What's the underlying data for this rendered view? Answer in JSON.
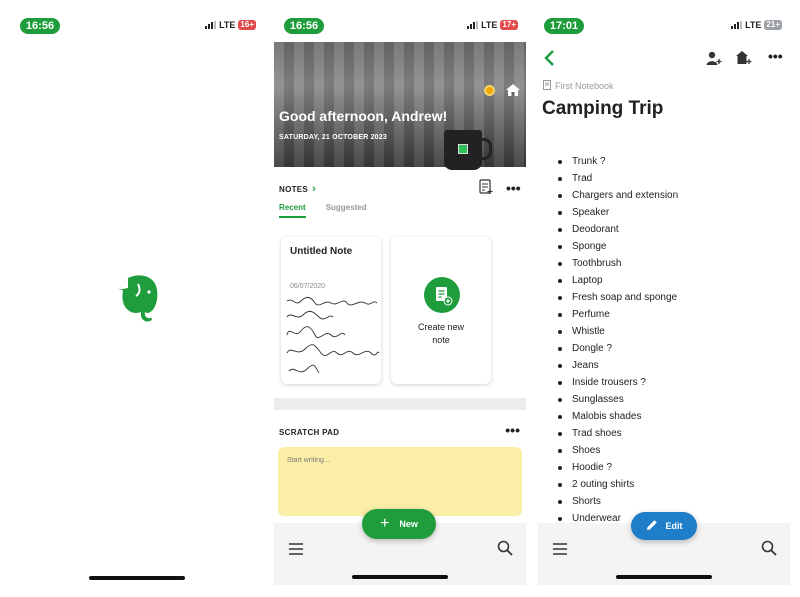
{
  "colors": {
    "brand_green": "#1f9d3c",
    "edit_blue": "#1e7ec8",
    "scratch_yellow": "#fbeea6"
  },
  "screen1": {
    "status": {
      "time": "16:56",
      "network": "LTE",
      "battery": "16+"
    },
    "logo_icon": "evernote-elephant-icon"
  },
  "screen2": {
    "status": {
      "time": "16:56",
      "network": "LTE",
      "battery": "17+"
    },
    "greeting": "Good afternoon, Andrew!",
    "date": "SATURDAY, 21 OCTOBER 2023",
    "notes_label": "NOTES",
    "tabs": [
      "Recent",
      "Suggested"
    ],
    "note_card": {
      "title": "Untitled Note",
      "date": "06/07/2020"
    },
    "create_card": {
      "line1": "Create new",
      "line2": "note"
    },
    "scratch_pad": {
      "title": "SCRATCH PAD",
      "placeholder": "Start writing..."
    },
    "new_button": "New"
  },
  "screen3": {
    "status": {
      "time": "17:01",
      "network": "LTE",
      "battery": "21+"
    },
    "notebook": "First Notebook",
    "title": "Camping Trip",
    "items": [
      "Trunk ?",
      "Trad",
      "Chargers and extension",
      "Speaker",
      "Deodorant",
      "Sponge",
      "Toothbrush",
      "Laptop",
      "Fresh soap and sponge",
      "Perfume",
      "Whistle",
      "Dongle ?",
      "Jeans",
      "Inside trousers ?",
      "Sunglasses",
      "Malobis shades",
      "Trad shoes",
      "Shoes",
      "Hoodie ?",
      "2 outing shirts",
      "Shorts",
      "Underwear"
    ],
    "edit_button": "Edit"
  }
}
